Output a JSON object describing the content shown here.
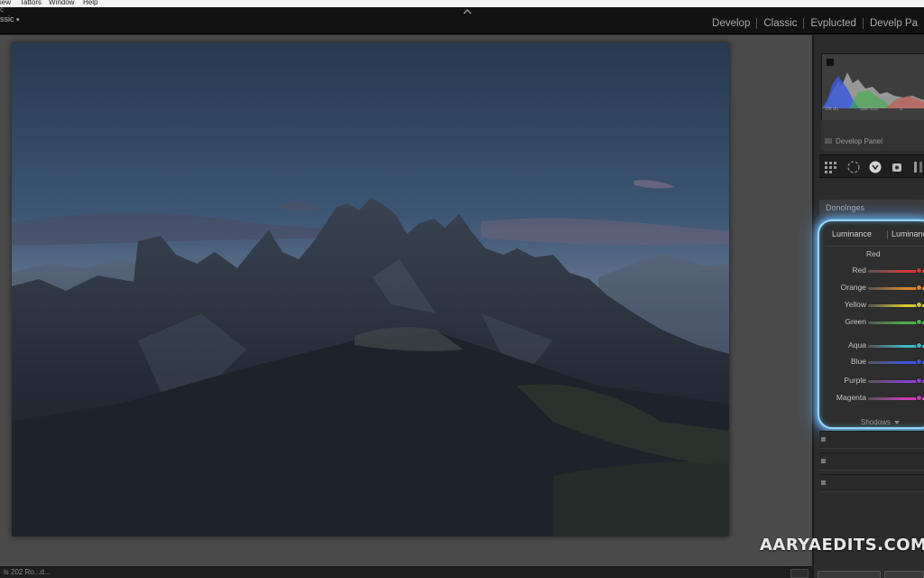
{
  "menu": {
    "items": [
      "iew",
      "Tattors",
      "Window",
      "Help"
    ]
  },
  "identity": {
    "line1": "c",
    "preset": "ssic",
    "caret": "▾"
  },
  "modules": [
    "Develop",
    "Classic",
    "Evplucted",
    "Develp Pa"
  ],
  "histogram": {
    "values": [
      "Dit du",
      "388 333",
      "S"
    ],
    "label": "Develop Panel"
  },
  "tools": [
    "grid-icon",
    "crop-circle-icon",
    "spot-removal-icon",
    "red-eye-icon",
    "graduated-filter-icon"
  ],
  "section": {
    "title": "Donolnges"
  },
  "hsl": {
    "tabs": [
      "Luminance",
      "Luminanc"
    ],
    "sub_header": "Red",
    "sub_header_b": "l",
    "rows": [
      {
        "label": "Red",
        "color": "#d03a3a",
        "value": 0.78
      },
      {
        "label": "Orange",
        "color": "#d8832c",
        "value": 0.78
      },
      {
        "label": "Yellow",
        "color": "#d6c52f",
        "value": 0.78
      },
      {
        "label": "Green",
        "color": "#49b04a",
        "value": 0.78
      },
      {
        "label": "Aqua",
        "color": "#3ab7c2",
        "value": 0.78
      },
      {
        "label": "Blue",
        "color": "#3d55d8",
        "value": 0.78
      },
      {
        "label": "Purple",
        "color": "#8b3dd0",
        "value": 0.78
      },
      {
        "label": "Magenta",
        "color": "#c83bb8",
        "value": 0.78
      }
    ],
    "footer": "Shodows"
  },
  "status": {
    "text": "ls 202 Ro...d..."
  },
  "watermark": "AARYAEDITS.COM"
}
